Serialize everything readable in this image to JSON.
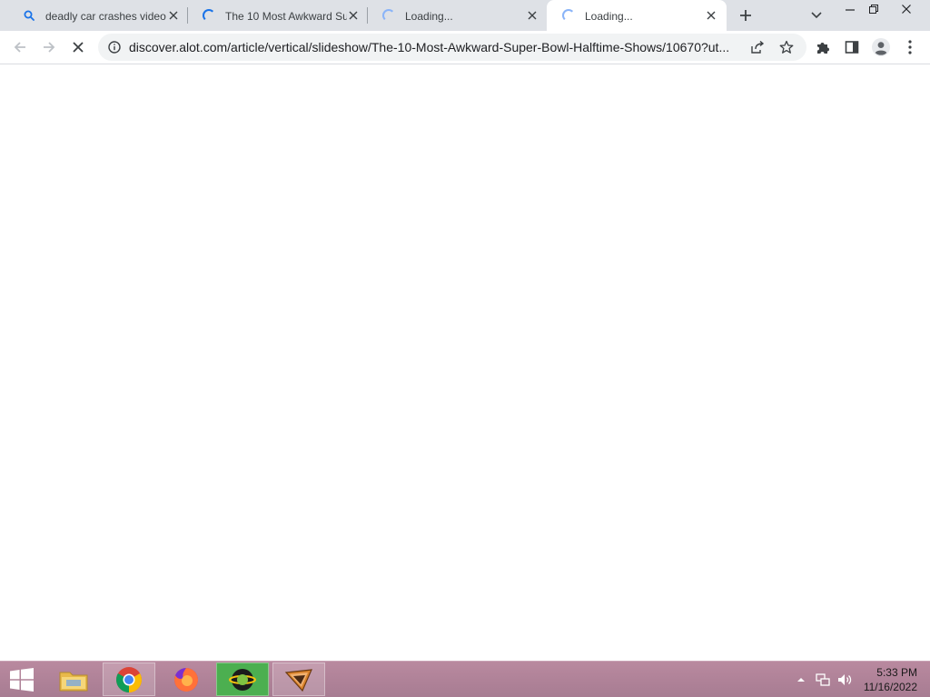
{
  "browser": {
    "tabs": [
      {
        "title": "deadly car crashes video",
        "icon": "search-icon",
        "state": "inactive"
      },
      {
        "title": "The 10 Most Awkward Su",
        "icon": "loading-spinner-icon",
        "state": "inactive"
      },
      {
        "title": "Loading...",
        "icon": "loading-spinner-icon",
        "state": "inactive"
      },
      {
        "title": "Loading...",
        "icon": "loading-spinner-icon",
        "state": "active"
      }
    ],
    "url": "discover.alot.com/article/vertical/slideshow/The-10-Most-Awkward-Super-Bowl-Halftime-Shows/10670?ut...",
    "accent_color": "#1a73e8"
  },
  "taskbar": {
    "apps": [
      "start-button",
      "file-explorer",
      "chrome",
      "firefox",
      "app-green",
      "app-slides"
    ],
    "clock_time": "5:33 PM",
    "clock_date": "11/16/2022"
  }
}
